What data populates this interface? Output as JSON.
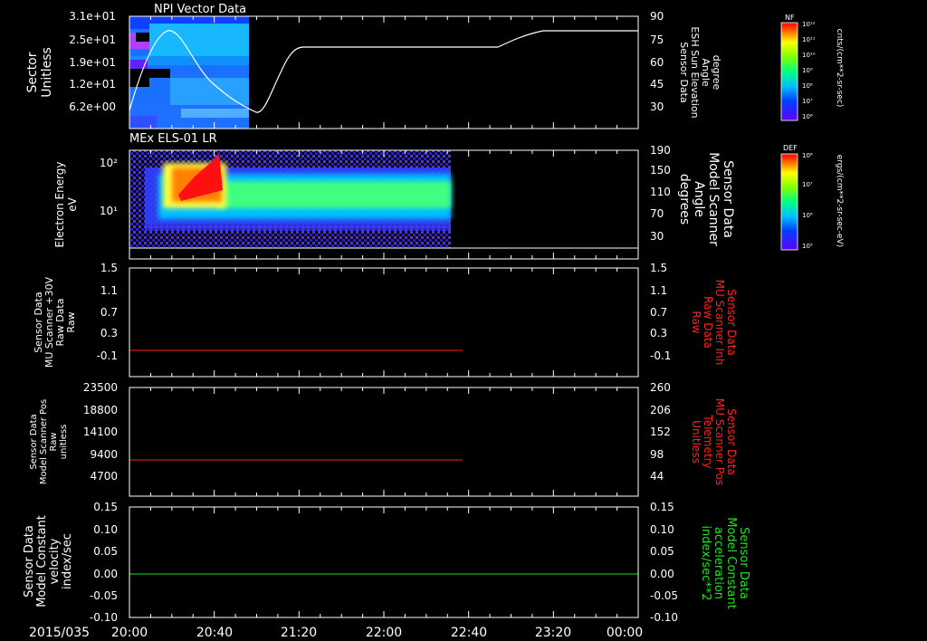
{
  "date_label": "2015/035",
  "x_ticks": [
    "20:00",
    "20:40",
    "21:20",
    "22:00",
    "22:40",
    "23:20",
    "00:00"
  ],
  "colors": {
    "frame": "#ffffff",
    "red": "#ff2020",
    "green": "#20e020",
    "white": "#ffffff"
  },
  "panels": [
    {
      "title": "NPI Vector Data",
      "left_label": [
        "Sector",
        "Unitless"
      ],
      "left_ticks": [
        "3.1e+01",
        "2.5e+01",
        "1.9e+01",
        "1.2e+01",
        "6.2e+00"
      ],
      "right_label": [
        "Sensor Data",
        "ESH Sun Elevation",
        "Angle",
        "degree"
      ],
      "right_ticks": [
        "90",
        "75",
        "60",
        "45",
        "30"
      ],
      "colorbar": {
        "title": "NF",
        "ticks": [
          "10¹²",
          "10¹¹",
          "10¹⁰",
          "10⁹",
          "10⁸",
          "10⁷",
          "10⁶"
        ],
        "unit": "cnts/(cm**2-sr-sec)"
      }
    },
    {
      "title": "MEx ELS-01 LR",
      "left_label": [
        "Electron Energy",
        "eV"
      ],
      "left_ticks": [
        "10²",
        "10¹"
      ],
      "right_label": [
        "Sensor Data",
        "Model Scanner",
        "Angle",
        "degrees"
      ],
      "right_ticks": [
        "190",
        "150",
        "110",
        "70",
        "30"
      ],
      "colorbar": {
        "title": "DEF",
        "ticks": [
          "10⁸",
          "10⁷",
          "10⁶",
          "10⁵"
        ],
        "unit": "ergs/(cm**2-sr-sec-eV)"
      }
    },
    {
      "title": "",
      "left_label": [
        "Sensor Data",
        "MU Scanner +30V",
        "Raw Data",
        "Raw"
      ],
      "left_ticks": [
        "1.5",
        "1.1",
        "0.7",
        "0.3",
        "-0.1"
      ],
      "right_label": [
        "Sensor Data",
        "MU Scanner Inh",
        "Raw Data",
        "Raw"
      ],
      "right_ticks": [
        "1.5",
        "1.1",
        "0.7",
        "0.3",
        "-0.1"
      ]
    },
    {
      "title": "",
      "left_label": [
        "Sensor Data",
        "Model Scanner Pos",
        "Raw",
        "unitless"
      ],
      "left_ticks": [
        "23500",
        "18800",
        "14100",
        "9400",
        "4700"
      ],
      "right_label": [
        "Sensor Data",
        "MU Scanner Pos",
        "Telemetry",
        "Unitless"
      ],
      "right_ticks": [
        "260",
        "206",
        "152",
        "98",
        "44"
      ]
    },
    {
      "title": "",
      "left_label": [
        "Sensor Data",
        "Model Constant",
        "velocity",
        "index/sec"
      ],
      "left_ticks": [
        "0.15",
        "0.10",
        "0.05",
        "0.00",
        "-0.05",
        "-0.10"
      ],
      "right_label": [
        "Sensor Data",
        "Model Constant",
        "acceleration",
        "index/sec**2"
      ],
      "right_ticks": [
        "0.15",
        "0.10",
        "0.05",
        "0.00",
        "-0.05",
        "-0.10"
      ]
    }
  ],
  "chart_data": [
    {
      "type": "heatmap",
      "title": "NPI Vector Data",
      "ylabel": "Sector Unitless",
      "y_ticks": [
        31,
        25,
        19,
        12,
        6.2
      ],
      "x_range": [
        "20:00",
        "00:00"
      ],
      "data_extent": [
        "20:00",
        "20:55"
      ],
      "overlay_series": {
        "name": "Sensor Data ESH Sun Elevation Angle",
        "y_axis": "right",
        "ylim": [
          20,
          90
        ],
        "x": [
          "20:00",
          "20:08",
          "20:20",
          "20:40",
          "21:00",
          "21:03",
          "21:10",
          "21:20",
          "22:40",
          "22:55",
          "23:20",
          "00:00"
        ],
        "y": [
          22,
          55,
          85,
          55,
          30,
          24,
          40,
          70,
          70,
          73,
          81,
          81
        ]
      }
    },
    {
      "type": "heatmap",
      "title": "MEx ELS-01 LR",
      "ylabel": "Electron Energy eV",
      "yscale": "log",
      "x_range": [
        "20:00",
        "00:00"
      ],
      "data_extent": [
        "20:00",
        "22:37"
      ],
      "overlay_series": {
        "name": "Sensor Data Model Scanner Angle",
        "y_axis": "right",
        "ylim": [
          0,
          190
        ],
        "x": [
          "20:00",
          "00:00"
        ],
        "y": [
          10,
          10
        ]
      }
    },
    {
      "type": "line",
      "series": [
        {
          "name": "MU Scanner Inh Raw Data",
          "x": [
            "20:00",
            "22:40"
          ],
          "y": [
            0,
            0
          ]
        }
      ],
      "ylim": [
        -0.3,
        1.5
      ]
    },
    {
      "type": "line",
      "series": [
        {
          "name": "MU Scanner Pos Telemetry",
          "x": [
            "20:00",
            "22:40"
          ],
          "y": [
            85,
            85
          ]
        }
      ],
      "ylim": [
        17,
        260
      ]
    },
    {
      "type": "line",
      "series": [
        {
          "name": "Model Constant acceleration",
          "x": [
            "20:00",
            "00:00"
          ],
          "y": [
            0,
            0
          ]
        }
      ],
      "ylim": [
        -0.1,
        0.15
      ]
    }
  ]
}
